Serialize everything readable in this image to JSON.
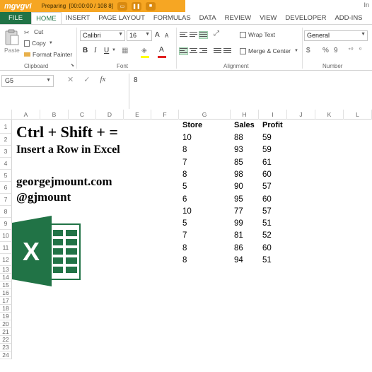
{
  "recorder": {
    "logo": "mgvgvi",
    "status": "Preparing",
    "timer": "[00:00:00 / 108 8]",
    "buttons": [
      "▭",
      "❚❚",
      "■"
    ]
  },
  "title_right": "In",
  "ribbon_tabs": [
    "FILE",
    "HOME",
    "INSERT",
    "PAGE LAYOUT",
    "FORMULAS",
    "DATA",
    "REVIEW",
    "VIEW",
    "DEVELOPER",
    "ADD-INS"
  ],
  "active_tab": "HOME",
  "clipboard": {
    "paste_label": "Paste",
    "cut_label": "Cut",
    "copy_label": "Copy",
    "format_painter_label": "Format Painter",
    "group_label": "Clipboard"
  },
  "font": {
    "name": "Calibri",
    "size": "16",
    "grow_label": "A",
    "shrink_label": "A",
    "bold": "B",
    "italic": "I",
    "underline": "U",
    "font_color_label": "A",
    "group_label": "Font"
  },
  "alignment": {
    "wrap_text_label": "Wrap Text",
    "merge_label": "Merge & Center",
    "group_label": "Alignment"
  },
  "number": {
    "format": "General",
    "currency": "$",
    "percent": "%",
    "comma": "9",
    "inc_decimal": "⁺⁰",
    "dec_decimal": "⁰",
    "group_label": "Number"
  },
  "formula_bar": {
    "name_box": "G5",
    "cancel": "✕",
    "enter": "✓",
    "fx": "fx",
    "content": "8"
  },
  "columns": [
    "A",
    "B",
    "C",
    "D",
    "E",
    "F",
    "G",
    "H",
    "I",
    "J",
    "K",
    "L"
  ],
  "rows": [
    "1",
    "2",
    "3",
    "4",
    "5",
    "6",
    "7",
    "8",
    "9",
    "10",
    "11",
    "12",
    "13",
    "14",
    "15",
    "16",
    "17",
    "18",
    "19",
    "20",
    "21",
    "22",
    "23",
    "24"
  ],
  "sheet_text": {
    "line1": "Ctrl + Shift + =",
    "line2": "Insert a Row in Excel",
    "line3": "georgejmount.com",
    "line4": "@gjmount"
  },
  "table": {
    "headers": [
      "Store",
      "Sales",
      "Profit"
    ],
    "rows": [
      [
        "10",
        "88",
        "59"
      ],
      [
        "8",
        "93",
        "59"
      ],
      [
        "7",
        "85",
        "61"
      ],
      [
        "8",
        "98",
        "60"
      ],
      [
        "5",
        "90",
        "57"
      ],
      [
        "6",
        "95",
        "60"
      ],
      [
        "10",
        "77",
        "57"
      ],
      [
        "5",
        "99",
        "51"
      ],
      [
        "7",
        "81",
        "52"
      ],
      [
        "8",
        "86",
        "60"
      ],
      [
        "8",
        "94",
        "51"
      ]
    ]
  },
  "colors": {
    "excel_green": "#217346",
    "recorder_orange": "#f6a623"
  }
}
